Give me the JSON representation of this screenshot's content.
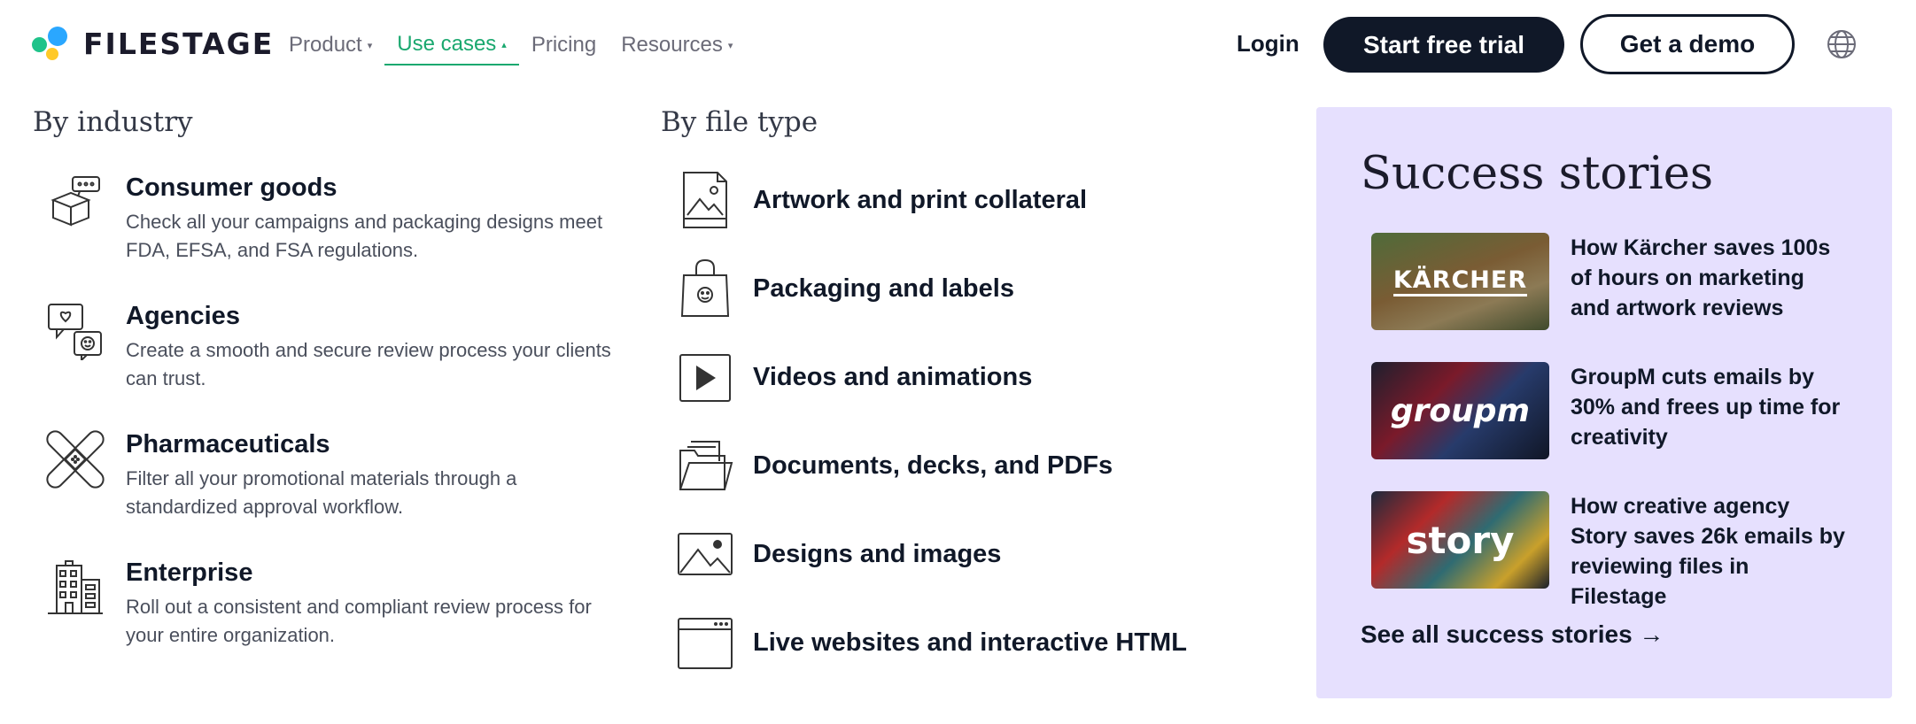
{
  "header": {
    "logo_text": "FILESTAGE",
    "nav": [
      {
        "label": "Product",
        "caret": "▾"
      },
      {
        "label": "Use cases",
        "caret": "▴"
      },
      {
        "label": "Pricing",
        "caret": ""
      },
      {
        "label": "Resources",
        "caret": "▾"
      }
    ],
    "login_label": "Login",
    "trial_label": "Start free trial",
    "demo_label": "Get a demo",
    "accent_color": "#1aa86f"
  },
  "by_industry": {
    "heading": "By industry",
    "items": [
      {
        "title": "Consumer goods",
        "description": "Check all your campaigns and packaging designs meet FDA, EFSA, and FSA regulations.",
        "icon": "box-icon"
      },
      {
        "title": "Agencies",
        "description": "Create a smooth and secure review process your clients can trust.",
        "icon": "chat-bubbles-icon"
      },
      {
        "title": "Pharmaceuticals",
        "description": "Filter all your promotional materials through a standardized approval workflow.",
        "icon": "bandage-icon"
      },
      {
        "title": "Enterprise",
        "description": "Roll out a consistent and compliant review process for your entire organization.",
        "icon": "building-icon"
      }
    ]
  },
  "by_file_type": {
    "heading": "By file type",
    "items": [
      {
        "label": "Artwork and print collateral",
        "icon": "artwork-icon"
      },
      {
        "label": "Packaging and labels",
        "icon": "shopping-bag-icon"
      },
      {
        "label": "Videos and animations",
        "icon": "play-icon"
      },
      {
        "label": "Documents, decks, and PDFs",
        "icon": "folder-icon"
      },
      {
        "label": "Designs and images",
        "icon": "image-icon"
      },
      {
        "label": "Live websites and interactive HTML",
        "icon": "browser-icon"
      }
    ]
  },
  "success_stories": {
    "title": "Success stories",
    "panel_color": "#e6e0fe",
    "stories": [
      {
        "text": "How Kärcher saves 100s of hours on marketing and artwork reviews",
        "thumb_word": "KÄRCHER"
      },
      {
        "text": "GroupM cuts emails by 30% and frees up time for creativity",
        "thumb_word": "groupm"
      },
      {
        "text": "How creative agency Story saves 26k emails by reviewing files in Filestage",
        "thumb_word": "story"
      }
    ],
    "see_all": "See all success stories →"
  }
}
